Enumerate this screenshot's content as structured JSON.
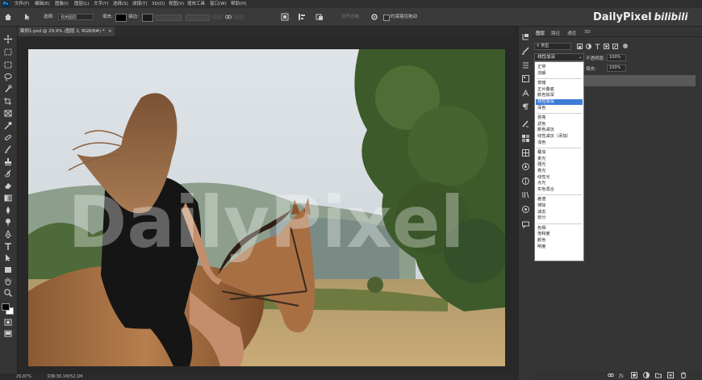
{
  "app": {
    "logo": "Ps",
    "menu": [
      "文件(F)",
      "编辑(E)",
      "图像(I)",
      "图层(L)",
      "文字(Y)",
      "选择(S)",
      "滤镜(T)",
      "3D(D)",
      "视图(V)",
      "增效工具",
      "窗口(W)",
      "帮助(H)"
    ]
  },
  "options_bar": {
    "select_label": "选择:",
    "select_value": "现用图层",
    "fill_label": "填充:",
    "stroke_label": "描边:",
    "align_edges": "对齐边缘",
    "constrain_path": "约束路径拖动"
  },
  "document": {
    "tab_title": "案例1.psd @ 29.9% (图层 2, RGB/8#) *",
    "close_symbol": "×",
    "photo_watermark": "DailyPixel"
  },
  "status": {
    "zoom": "29.87%",
    "doc_info": "文档:36.1M/52.1M"
  },
  "panel": {
    "tabs": [
      "图层",
      "路径",
      "通道",
      "3D"
    ],
    "filter_kind": "类型",
    "blend_mode_current": "线性加深",
    "opacity_label": "不透明度:",
    "opacity_value": "100%",
    "fill_label": "填充:",
    "fill_value": "100%",
    "blend_groups": [
      [
        "正常",
        "溶解"
      ],
      [
        "变暗",
        "正片叠底",
        "颜色加深",
        "线性加深",
        "深色"
      ],
      [
        "变亮",
        "滤色",
        "颜色减淡",
        "线性减淡（添加）",
        "浅色"
      ],
      [
        "叠加",
        "柔光",
        "强光",
        "亮光",
        "线性光",
        "点光",
        "实色混合"
      ],
      [
        "差值",
        "排除",
        "减去",
        "划分"
      ],
      [
        "色相",
        "饱和度",
        "颜色",
        "明度"
      ]
    ],
    "blend_highlighted": "线性加深"
  },
  "watermark": {
    "brand": "DailyPixel",
    "site": "bilibili"
  },
  "colors": {
    "accent": "#3d7bd9",
    "ps_blue": "#31a8ff",
    "ui_dark": "#282828",
    "ui_panel": "#353535"
  }
}
